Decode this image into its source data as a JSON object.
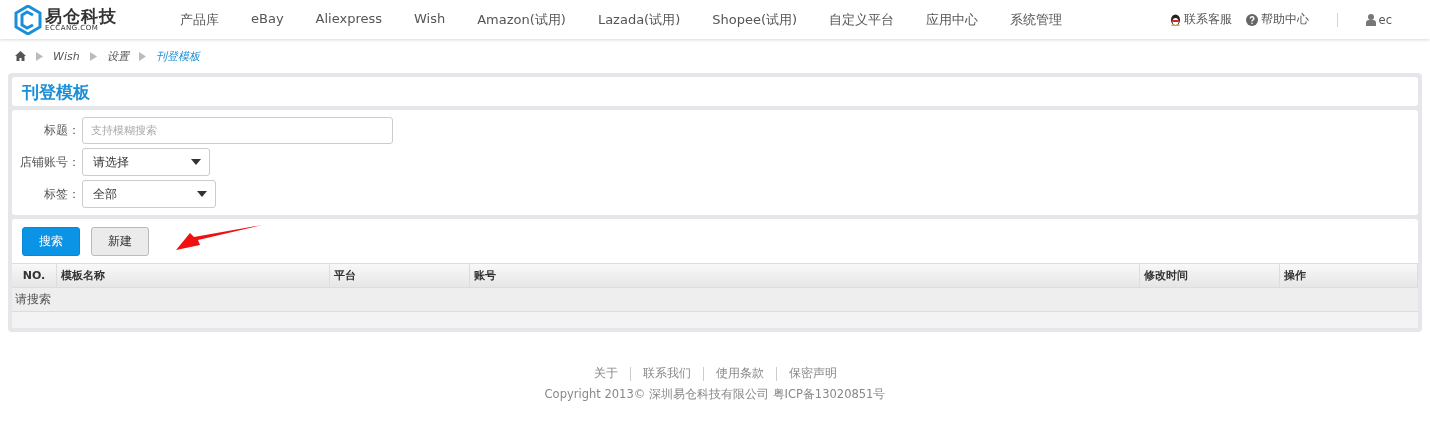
{
  "logo": {
    "name": "易仓科技",
    "domain": "ECCANG.COM"
  },
  "nav": [
    {
      "label": "产品库"
    },
    {
      "label": "eBay"
    },
    {
      "label": "Aliexpress"
    },
    {
      "label": "Wish"
    },
    {
      "label": "Amazon(试用)"
    },
    {
      "label": "Lazada(试用)"
    },
    {
      "label": "Shopee(试用)"
    },
    {
      "label": "自定义平台"
    },
    {
      "label": "应用中心"
    },
    {
      "label": "系统管理"
    }
  ],
  "header_links": [
    {
      "kind": "qq",
      "label": "联系客服"
    },
    {
      "kind": "help",
      "label": "帮助中心"
    }
  ],
  "user": {
    "name": "ec"
  },
  "breadcrumb": [
    {
      "label": "Wish",
      "selected": false
    },
    {
      "label": "设置",
      "selected": false
    },
    {
      "label": "刊登模板",
      "selected": true
    }
  ],
  "page_title": "刊登模板",
  "filters": [
    {
      "kind": "text",
      "label": "标题：",
      "placeholder": "支持模糊搜索"
    },
    {
      "kind": "select",
      "label": "店铺账号：",
      "value": "请选择"
    },
    {
      "kind": "select",
      "label": "标签：",
      "value": "全部"
    }
  ],
  "buttons": [
    {
      "label": "搜索",
      "primary": true
    },
    {
      "label": "新建",
      "primary": false
    }
  ],
  "table": {
    "columns": [
      "NO.",
      "模板名称",
      "平台",
      "账号",
      "修改时间",
      "操作"
    ],
    "empty_message": "请搜索"
  },
  "footer": {
    "links": [
      "关于",
      "联系我们",
      "使用条款",
      "保密声明"
    ],
    "copyright": "Copyright 2013© 深圳易仓科技有限公司 粤ICP备13020851号"
  }
}
